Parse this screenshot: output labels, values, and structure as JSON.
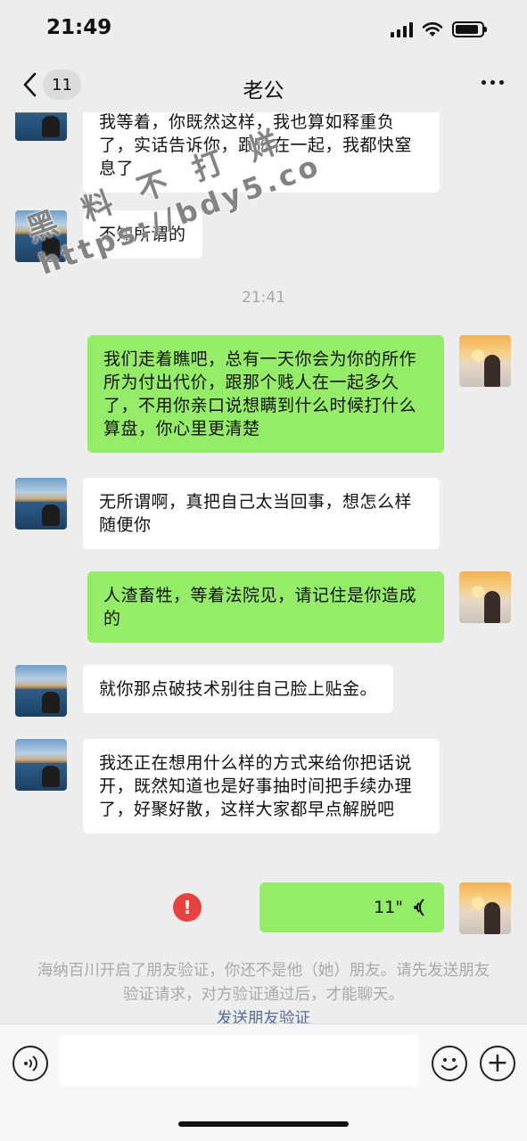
{
  "status_bar": {
    "time": "21:49",
    "battery_level": 0.9
  },
  "nav": {
    "unread_count": "11",
    "title": "老公"
  },
  "watermark": {
    "line1": "黑 料 不 打 烊",
    "line2": "https://bdy5.co"
  },
  "messages": [
    {
      "side": "in",
      "text": "我等着，你既然这样，我也算如释重负了，实话告诉你，跟你在一起，我都快窒息了"
    },
    {
      "side": "in",
      "text": "不知所谓的"
    },
    {
      "side": "out",
      "text": "我们走着瞧吧，总有一天你会为你的所作所为付出代价，跟那个贱人在一起多久了，不用你亲口说想瞒到什么时候打什么算盘，你心里更清楚"
    },
    {
      "side": "in",
      "text": "无所谓啊，真把自己太当回事，想怎么样随便你"
    },
    {
      "side": "out",
      "text": "人渣畜牲，等着法院见，请记住是你造成的"
    },
    {
      "side": "in",
      "text": "就你那点破技术别往自己脸上贴金。"
    },
    {
      "side": "in",
      "text": "我还正在想用什么样的方式来给你把话说开，既然知道也是好事抽时间把手续办理了，好聚好散，这样大家都早点解脱吧"
    }
  ],
  "timestamp": "21:41",
  "voice_message": {
    "duration": "11\"",
    "send_failed": true,
    "error_glyph": "!"
  },
  "system_notice": {
    "text": "海纳百川开启了朋友验证，你还不是他（她）朋友。请先发送朋友验证请求，对方验证通过后，才能聊天。",
    "link": "发送朋友验证"
  },
  "input_bar": {
    "placeholder": "",
    "plus_glyph": "+"
  },
  "colors": {
    "bubble_out": "#95ec69",
    "bubble_in": "#ffffff",
    "background": "#ededed",
    "error": "#e64340",
    "link": "#576b95"
  }
}
